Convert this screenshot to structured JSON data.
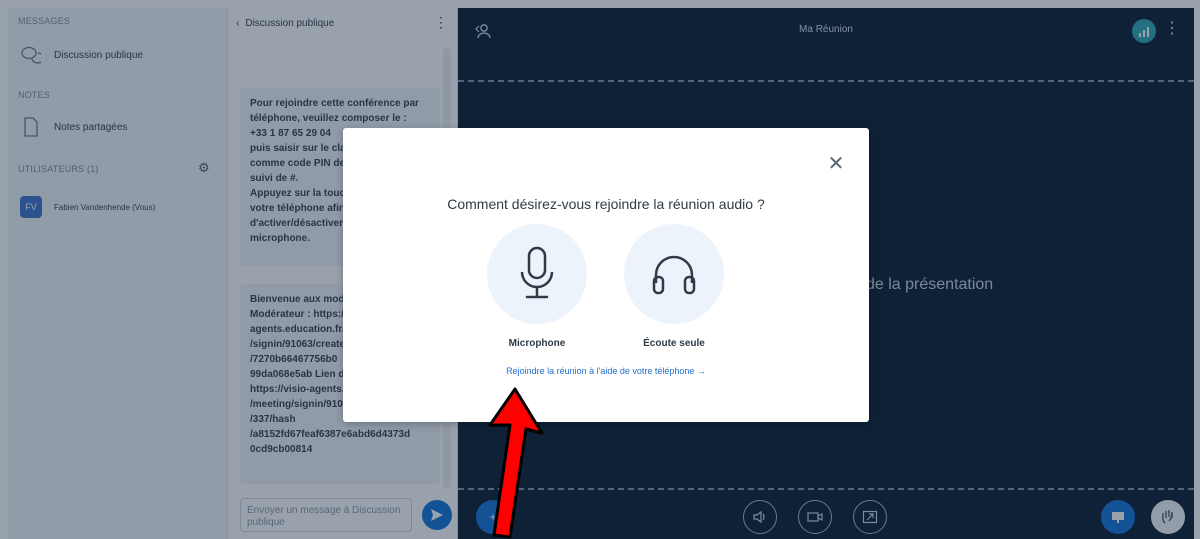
{
  "sidebar": {
    "messages_header": "MESSAGES",
    "public_chat": "Discussion publique",
    "notes_header": "NOTES",
    "shared_notes": "Notes partagées",
    "users_header": "UTILISATEURS (1)",
    "user": {
      "initials": "FV",
      "name": "Fabien Vandenhende (Vous)"
    }
  },
  "chat": {
    "title": "Discussion publique",
    "message_phone": "Pour rejoindre cette conférence par téléphone, veuillez composer le :\n+33 1 87 65 29 04\npuis saisir sur le clavier\ncomme code PIN de conférence\nsuivi de #.\nAppuyez sur la touche 0 sur\nvotre téléphone afin\nd'activer/désactiver le\nmicrophone.",
    "message_welcome": "Bienvenue aux modérateurs\nModérateur : https://visio-\nagents.education.fr/meeting\n/signin/91063/create\n/7270b66467756b0\n99da068e5ab Lien d'\nhttps://visio-agents.\n/meeting/signin/91063\n/337/hash\n/a8152fd67feaf6387e6abd6d4373d\n0cd9cb00814",
    "input_placeholder": "Envoyer un message à Discussion publique"
  },
  "stage": {
    "title": "Ma Réunion",
    "presentation_text": "de la présentation"
  },
  "modal": {
    "title": "Comment désirez-vous rejoindre la réunion audio ?",
    "option_microphone": "Microphone",
    "option_listen": "Écoute seule",
    "phone_link": "Rejoindre la réunion à l'aide de votre téléphone →"
  },
  "colors": {
    "accent": "#0f70d7",
    "stage_bg": "#06172a",
    "annotation_arrow": "#ff0000"
  }
}
